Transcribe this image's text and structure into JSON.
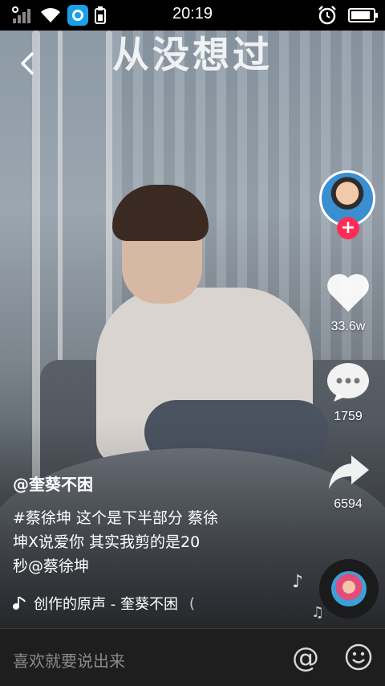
{
  "status_bar": {
    "time": "20:19",
    "battery_level": 0.9,
    "icons": [
      "signal-icon",
      "wifi-icon",
      "app-notification-icon",
      "sim-icon",
      "alarm-icon",
      "battery-icon"
    ]
  },
  "video": {
    "overlay_text": "从没想过"
  },
  "right_rail": {
    "like_count": "33.6w",
    "comment_count": "1759",
    "share_count": "6594",
    "follow_symbol": "+"
  },
  "post": {
    "author": "@奎葵不困",
    "caption_line1": "#蔡徐坤 这个是下半部分 蔡徐",
    "caption_line2": "坤X说爱你  其实我剪的是20",
    "caption_line3": "秒@蔡徐坤",
    "music_title": "创作的原声 - 奎葵不困"
  },
  "comment_bar": {
    "placeholder": "喜欢就要说出来",
    "at_symbol": "@"
  },
  "colors": {
    "accent": "#fe2c55",
    "bar_bg": "#1e1e1f"
  }
}
